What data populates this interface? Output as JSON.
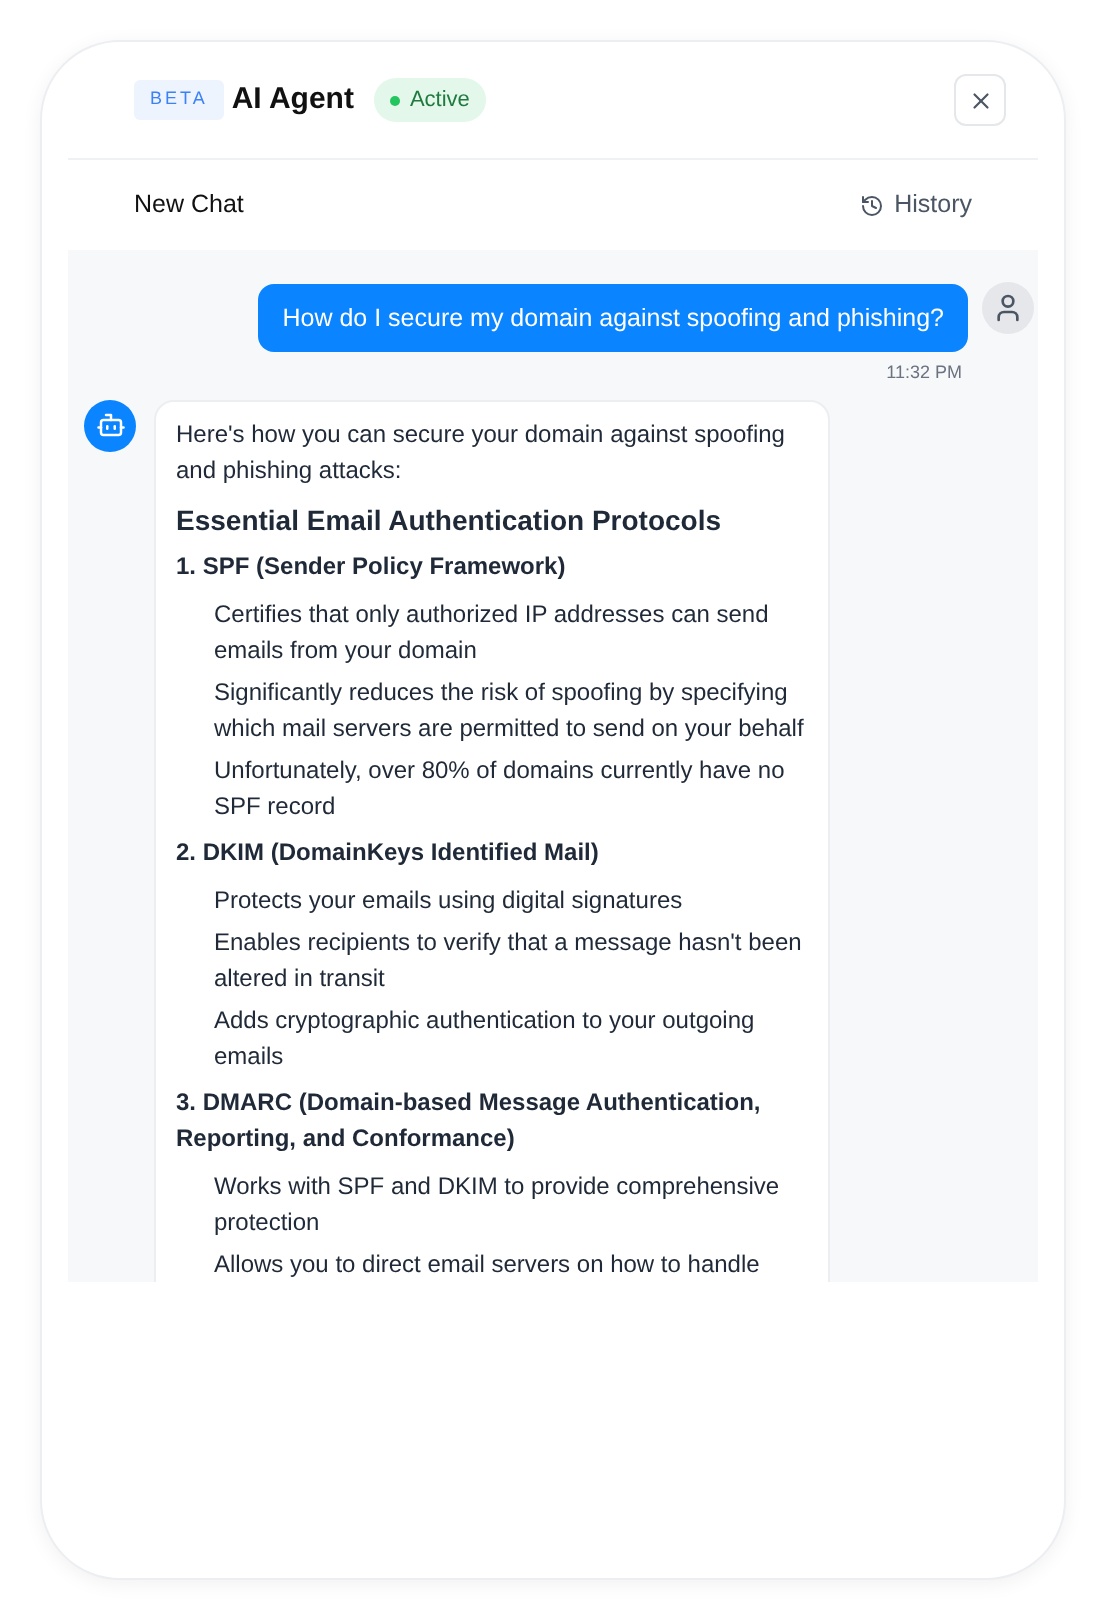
{
  "header": {
    "badge": "BETA",
    "title": "AI Agent",
    "status": {
      "label": "Active",
      "online": true
    }
  },
  "toolbar": {
    "new_chat": "New Chat",
    "history": "History"
  },
  "messages": [
    {
      "kind": "user",
      "text": "How do I secure my domain against spoofing and phishing?",
      "time": "11:32 PM"
    },
    {
      "kind": "agent",
      "intro": "Here's how you can secure your domain against spoofing and phishing attacks:",
      "heading": "Essential Email Authentication Protocols",
      "sections": [
        {
          "title": "1. SPF (Sender Policy Framework)",
          "points": [
            "Certifies that only authorized IP addresses can send emails from your domain",
            "Significantly reduces the risk of spoofing by specifying which mail servers are permitted to send on your behalf",
            "Unfortunately, over 80% of domains currently have no SPF record"
          ]
        },
        {
          "title": "2. DKIM (DomainKeys Identified Mail)",
          "points": [
            "Protects your emails using digital signatures",
            "Enables recipients to verify that a message hasn't been altered in transit",
            "Adds cryptographic authentication to your outgoing emails"
          ]
        },
        {
          "title": "3. DMARC (Domain-based Message Authentication, Reporting, and Conformance)",
          "points": [
            "Works with SPF and DKIM to provide comprehensive protection",
            "Allows you to direct email servers on how to handle"
          ]
        }
      ]
    }
  ]
}
